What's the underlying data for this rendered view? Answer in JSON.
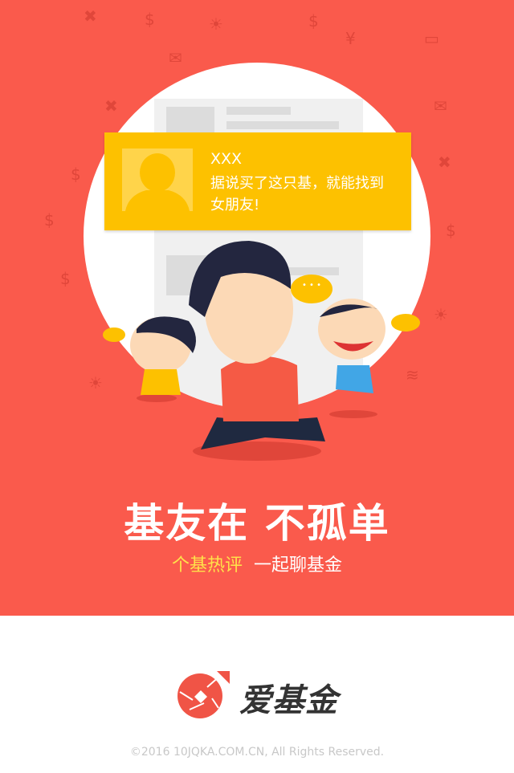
{
  "card": {
    "name": "XXX",
    "message": "据说买了这只基，就能找到女朋友!"
  },
  "speech_bubble": "• • •",
  "headline": "基友在 不孤单",
  "subtitle": {
    "highlight": "个基热评",
    "rest": "一起聊基金"
  },
  "brand": {
    "name": "爱基金"
  },
  "copyright": "©2016 10JQKA.COM.CN, All Rights Reserved.",
  "colors": {
    "background": "#fa5a4c",
    "card": "#fdc100",
    "subtitle_highlight": "#ffe14a"
  }
}
